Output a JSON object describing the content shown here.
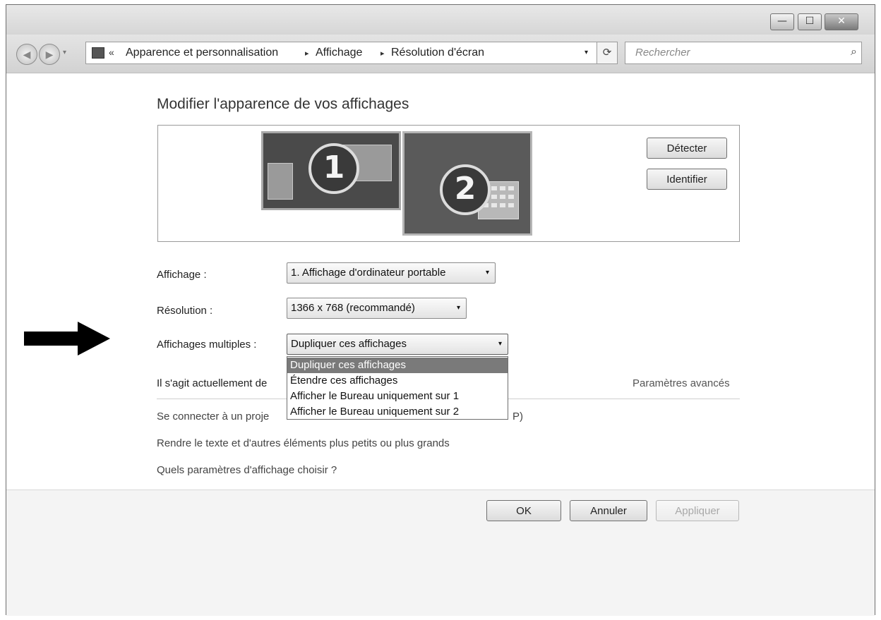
{
  "window": {
    "controls": {
      "minimize_glyph": "—",
      "maximize_glyph": "☐",
      "close_glyph": "✕"
    }
  },
  "navbar": {
    "back_glyph": "◀",
    "forward_glyph": "▶",
    "history_glyph": "▾",
    "address": {
      "overflow_glyph": "«",
      "crumbs": [
        "Apparence et personnalisation",
        "Affichage",
        "Résolution d'écran"
      ],
      "separator": "▸",
      "dropdown_glyph": "▾"
    },
    "refresh_glyph": "⟳",
    "search": {
      "placeholder": "Rechercher",
      "icon_glyph": "⌕"
    }
  },
  "main": {
    "heading": "Modifier l'apparence de vos affichages",
    "monitors": [
      {
        "number": "1"
      },
      {
        "number": "2"
      }
    ],
    "detect_label": "Détecter",
    "identify_label": "Identifier",
    "fields": {
      "display": {
        "label": "Affichage :",
        "value": "1. Affichage d'ordinateur portable"
      },
      "resolution": {
        "label": "Résolution :",
        "value": "1366 x 768 (recommandé)"
      },
      "multiple": {
        "label": "Affichages multiples :",
        "value": "Dupliquer ces affichages",
        "options": [
          "Dupliquer ces affichages",
          "Étendre ces affichages",
          "Afficher le Bureau uniquement sur 1",
          "Afficher le Bureau uniquement sur 2"
        ],
        "highlighted_index": 0
      }
    },
    "info_text": "Il s'agit actuellement de",
    "advanced_link": "Paramètres avancés",
    "links": [
      "Se connecter à un proje",
      "Rendre le texte et d'autres éléments plus petits ou plus grands",
      "Quels paramètres d'affichage choisir ?"
    ],
    "link1_tail": "P)",
    "dropdown_glyph": "▾"
  },
  "footer": {
    "ok_label": "OK",
    "cancel_label": "Annuler",
    "apply_label": "Appliquer",
    "apply_enabled": false
  },
  "colors": {
    "window_chrome": "#d6d6d6",
    "selection": "#7a7a7a",
    "arrow": "#000000"
  }
}
